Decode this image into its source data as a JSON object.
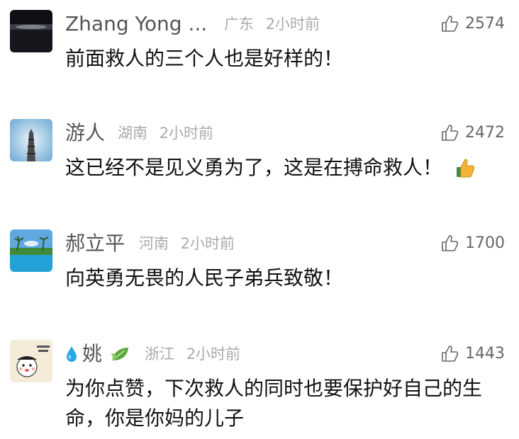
{
  "comments": [
    {
      "username": "Zhang Yong ...",
      "location": "广东",
      "time": "2小时前",
      "likes": "2574",
      "text": "前面救人的三个人也是好样的！"
    },
    {
      "username": "游人",
      "location": "湖南",
      "time": "2小时前",
      "likes": "2472",
      "text": "这已经不是见义勇为了，这是在搏命救人！",
      "inline_icon": "thumbs-up-emoji-icon"
    },
    {
      "username": "郝立平",
      "location": "河南",
      "time": "2小时前",
      "likes": "1700",
      "text": "向英勇无畏的人民子弟兵致敬！"
    },
    {
      "username": "姚",
      "location": "浙江",
      "time": "2小时前",
      "likes": "1443",
      "text": "为你点赞，下次救人的同时也要保护好自己的生命，你是你妈的儿子",
      "name_prefix_icon": "water-drop-icon",
      "name_suffix_icon": "leaf-icon"
    }
  ],
  "icons": {
    "like": "thumbs-up-outline-icon"
  },
  "colors": {
    "username": "#555555",
    "meta": "#aaaaaa",
    "text": "#111111",
    "drop": "#2aa7e8",
    "leaf": "#5aa83a"
  }
}
